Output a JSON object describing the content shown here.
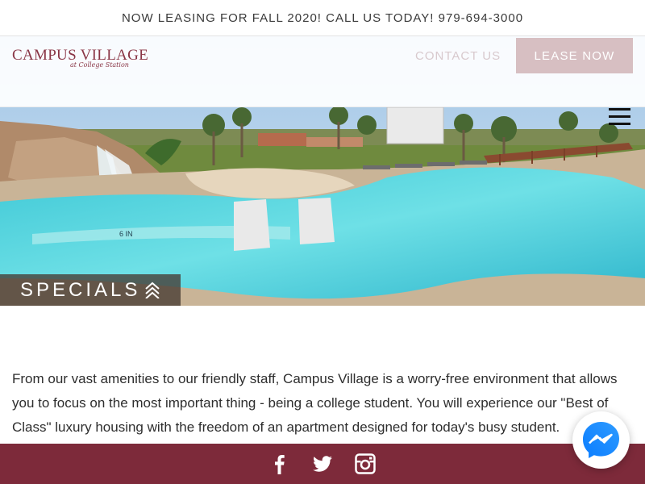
{
  "announcement": "NOW LEASING FOR FALL 2020! CALL US TODAY! 979-694-3000",
  "logo": {
    "name": "CAMPUS VILLAGE",
    "tagline": "at College Station"
  },
  "nav": {
    "contact_label": "CONTACT US",
    "lease_label": "LEASE NOW"
  },
  "hero": {
    "icons": [
      "menu-icon",
      "double-chevron-up-icon"
    ],
    "specials_label": "SPECIALS",
    "pool_depth_marker": "6 IN"
  },
  "intro": {
    "text": "From our vast amenities to our friendly staff, Campus Village is a worry-free environment that allows you to focus on the most important thing - being a college student. You will experience our \"Best of Class\" luxury housing with the freedom of an apartment designed for today's busy student."
  },
  "social": {
    "icons": [
      "facebook-icon",
      "twitter-icon",
      "instagram-icon"
    ]
  },
  "chat": {
    "icon": "messenger-icon"
  },
  "colors": {
    "brand": "#7d2a3a",
    "accent": "#d7bfc2",
    "messenger": "#1877f2"
  }
}
